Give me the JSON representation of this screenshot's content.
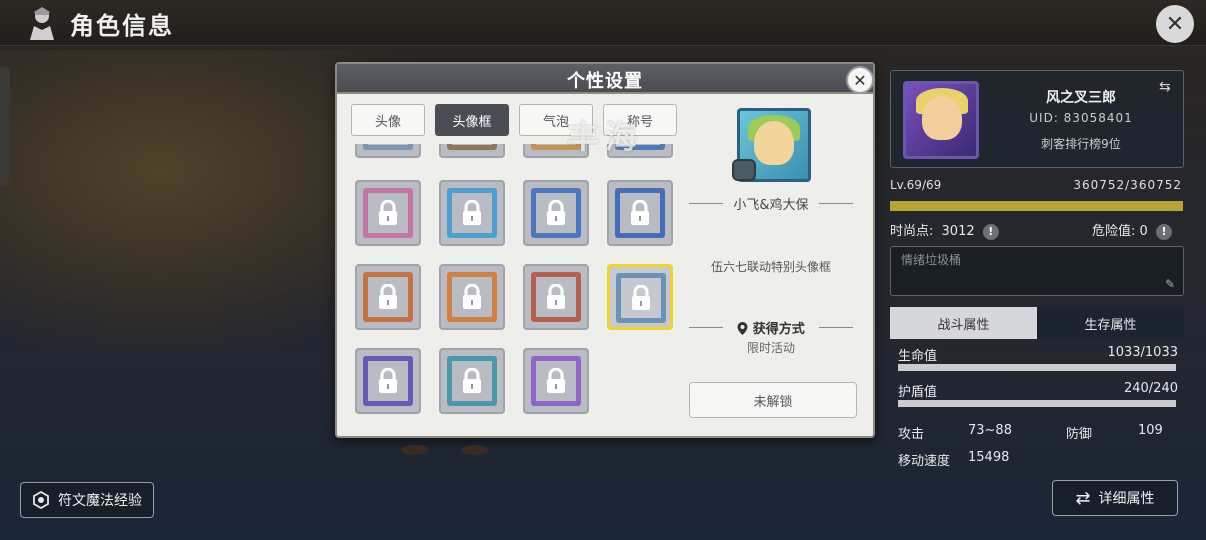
{
  "page": {
    "title": "角色信息"
  },
  "modal": {
    "title": "个性设置",
    "tabs": [
      "头像",
      "头像框",
      "气泡",
      "称号"
    ],
    "active_tab": 1,
    "watermark": "丰海",
    "selected_item": {
      "name": "小飞&鸡大保",
      "description": "伍六七联动特别头像框",
      "source_title": "获得方式",
      "source_value": "限时活动",
      "button_label": "未解锁"
    }
  },
  "player": {
    "name": "风之叉三郎",
    "uid": "UID: 83058401",
    "rank": "刺客排行榜9位",
    "level": "Lv.69/69",
    "exp": "360752/360752",
    "exp_fraction": 1.0,
    "fashion_label": "时尚点:",
    "fashion_value": "3012",
    "danger_label": "危险值:",
    "danger_value": "0",
    "mood_placeholder": "情绪垃圾桶"
  },
  "attr_tabs": [
    "战斗属性",
    "生存属性"
  ],
  "attributes": {
    "hp_label": "生命值",
    "hp_value": "1033/1033",
    "shield_label": "护盾值",
    "shield_value": "240/240",
    "attack_label": "攻击",
    "attack_value": "73~88",
    "defense_label": "防御",
    "defense_value": "109",
    "speed_label": "移动速度",
    "speed_value": "15498"
  },
  "buttons": {
    "rune_exp": "符文魔法经验",
    "detail_attr": "详细属性"
  },
  "colors": {
    "accent_gold": "#b8a437",
    "selected_border": "#f2d32a",
    "modal_header": "#4a4c52"
  },
  "icons": [
    "character-icon",
    "close-icon",
    "lock-icon",
    "location-pin-icon",
    "swap-icon",
    "info-icon",
    "pencil-icon",
    "rune-icon",
    "swap-arrows-icon"
  ]
}
